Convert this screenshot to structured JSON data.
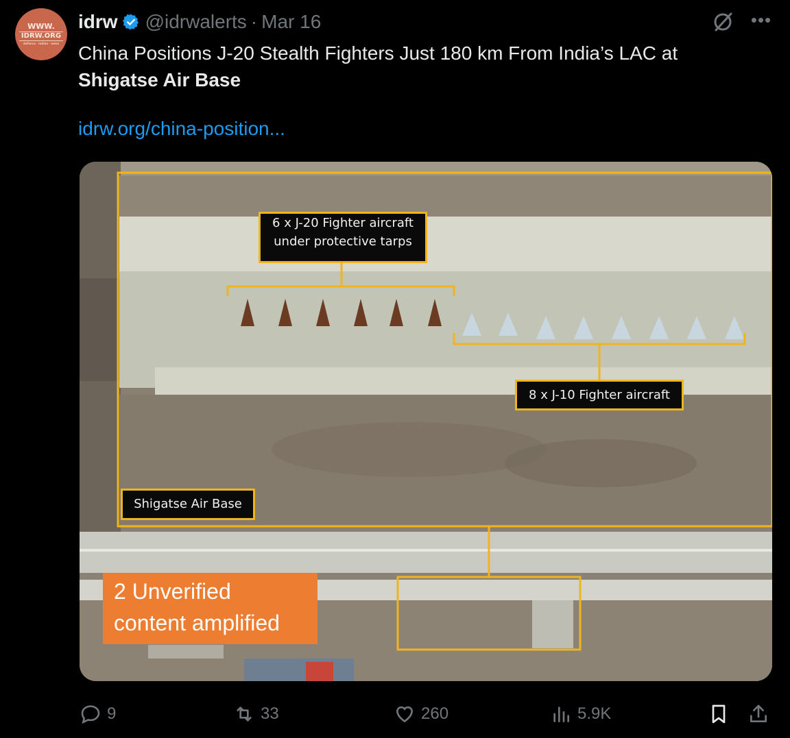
{
  "author": {
    "name": "idrw",
    "handle": "@idrwalerts",
    "separator": "·",
    "date": "Mar 16",
    "avatar_text": {
      "line1": "WWW.",
      "line2": "IDRW.ORG",
      "line3": "defence · indian · news"
    }
  },
  "tweet": {
    "text_line1": "China Positions J-20 Stealth Fighters Just 180 km From India’s LAC at",
    "text_bold": "Shigatse Air Base",
    "link": "idrw.org/china-position..."
  },
  "media": {
    "callout_j20_line1": "6 x J-20 Fighter aircraft",
    "callout_j20_line2": "under protective tarps",
    "callout_j10": "8 x J-10 Fighter aircraft",
    "callout_base": "Shigatse Air Base"
  },
  "overlay": {
    "line1": "2 Unverified",
    "line2": "content amplified",
    "color": "#ed7d31"
  },
  "actions": {
    "replies": "9",
    "reposts": "33",
    "likes": "260",
    "views": "5.9K"
  },
  "icons": [
    "verified-icon",
    "grok-icon",
    "more-icon",
    "reply-icon",
    "repost-icon",
    "like-icon",
    "views-icon",
    "bookmark-icon",
    "share-icon"
  ],
  "colors": {
    "link": "#1d9bf0",
    "verified": "#1d9bf0",
    "annotation": "#f0b41e"
  }
}
